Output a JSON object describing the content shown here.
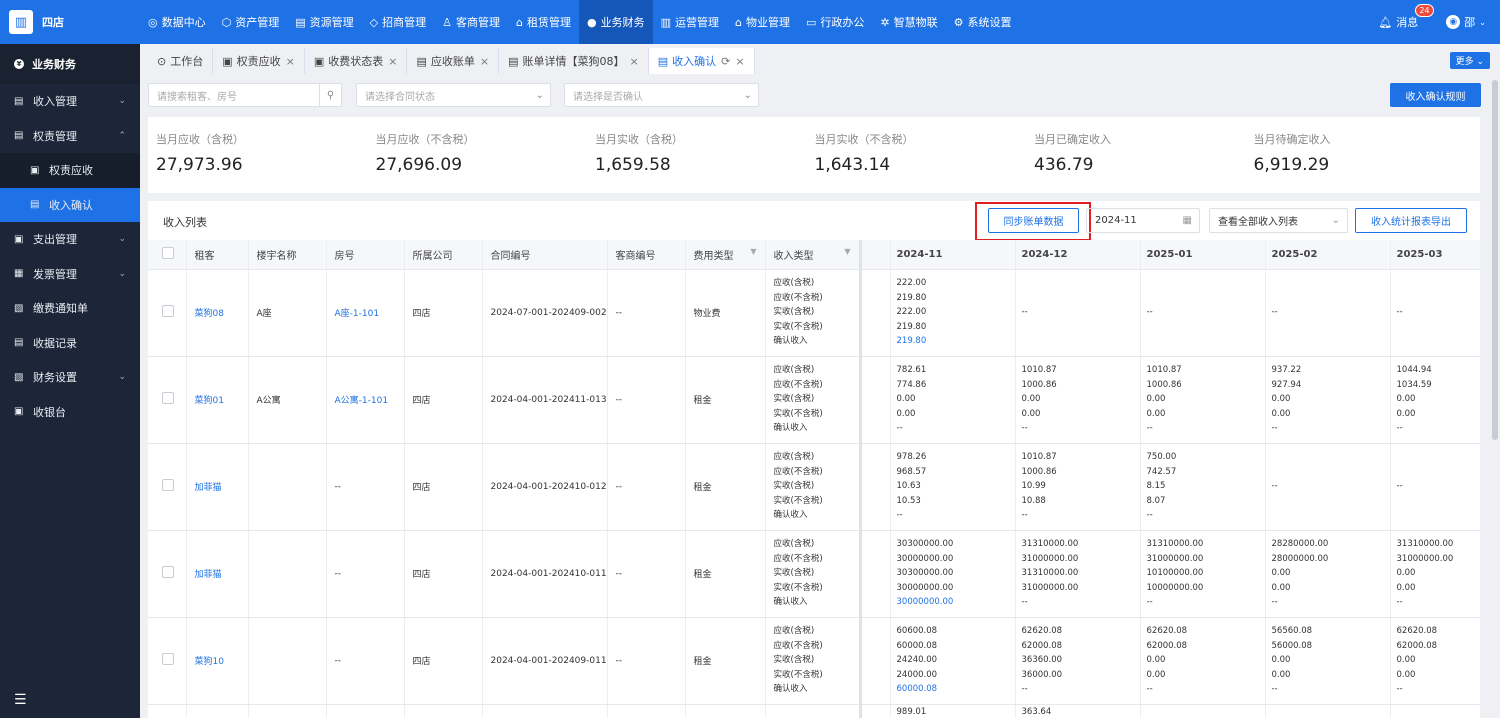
{
  "app": {
    "logo_icon": "building-icon",
    "org_name": "四店"
  },
  "nav": [
    {
      "icon": "◎",
      "label": "数据中心"
    },
    {
      "icon": "⬡",
      "label": "资产管理"
    },
    {
      "icon": "▤",
      "label": "资源管理"
    },
    {
      "icon": "◇",
      "label": "招商管理"
    },
    {
      "icon": "♙",
      "label": "客商管理"
    },
    {
      "icon": "⌂",
      "label": "租赁管理"
    },
    {
      "icon": "●",
      "label": "业务财务"
    },
    {
      "icon": "▥",
      "label": "运营管理"
    },
    {
      "icon": "⌂",
      "label": "物业管理"
    },
    {
      "icon": "▭",
      "label": "行政办公"
    },
    {
      "icon": "✲",
      "label": "智慧物联"
    },
    {
      "icon": "⚙",
      "label": "系统设置"
    }
  ],
  "header": {
    "msg_label": "消息",
    "msg_count": "24",
    "user": "邵"
  },
  "sidebar": {
    "title": "业务财务",
    "items": [
      {
        "icon": "▤",
        "label": "收入管理",
        "chev": "⌄"
      },
      {
        "icon": "▤",
        "label": "权责管理",
        "chev": "⌃"
      },
      {
        "icon": "▣",
        "label": "权责应收"
      },
      {
        "icon": "▤",
        "label": "收入确认"
      },
      {
        "icon": "▣",
        "label": "支出管理",
        "chev": "⌄"
      },
      {
        "icon": "▦",
        "label": "发票管理",
        "chev": "⌄"
      },
      {
        "icon": "▧",
        "label": "缴费通知单"
      },
      {
        "icon": "▤",
        "label": "收据记录"
      },
      {
        "icon": "▧",
        "label": "财务设置",
        "chev": "⌄"
      },
      {
        "icon": "▣",
        "label": "收银台"
      }
    ],
    "bottom_icon": "☰"
  },
  "tabs": [
    {
      "icon": "⊙",
      "label": "工作台",
      "close": ""
    },
    {
      "icon": "▣",
      "label": "权责应收",
      "close": "×"
    },
    {
      "icon": "▣",
      "label": "收费状态表",
      "close": "×"
    },
    {
      "icon": "▤",
      "label": "应收账单",
      "close": "×"
    },
    {
      "icon": "▤",
      "label": "账单详情【菜狗08】",
      "close": "×"
    },
    {
      "icon": "▤",
      "label": "收入确认",
      "close": "×",
      "refresh": "⟳"
    }
  ],
  "more_label": "更多 ⌄",
  "filters": {
    "search_placeholder": "请搜索租客、房号",
    "contract_placeholder": "请选择合同状态",
    "confirm_placeholder": "请选择是否确认"
  },
  "rule_button": "收入确认规则",
  "stats": [
    {
      "label": "当月应收（含税）",
      "value": "27,973.96"
    },
    {
      "label": "当月应收（不含税）",
      "value": "27,696.09"
    },
    {
      "label": "当月实收（含税）",
      "value": "1,659.58"
    },
    {
      "label": "当月实收（不含税）",
      "value": "1,643.14"
    },
    {
      "label": "当月已确定收入",
      "value": "436.79"
    },
    {
      "label": "当月待确定收入",
      "value": "6,919.29"
    }
  ],
  "list": {
    "title": "收入列表",
    "sync_button": "同步账单数据",
    "date_value": "2024-11",
    "view_select": "查看全部收入列表",
    "export_button": "收入统计报表导出"
  },
  "columns": [
    "租客",
    "楼宇名称",
    "房号",
    "所属公司",
    "合同编号",
    "客商编号",
    "费用类型",
    "收入类型"
  ],
  "months": [
    "2024-11",
    "2024-12",
    "2025-01",
    "2025-02",
    "2025-03"
  ],
  "income_types": [
    "应收(含税)",
    "应收(不含税)",
    "实收(含税)",
    "实收(不含税)",
    "确认收入"
  ],
  "rows": [
    {
      "tenant": "菜狗08",
      "building": "A座",
      "room": "A座-1-101",
      "company": "四店",
      "contract": "2024-07-001-202409-0028",
      "merchant": "--",
      "fee": "物业费",
      "m": [
        [
          "222.00",
          "219.80",
          "222.00",
          "219.80",
          "219.80"
        ],
        [
          "--"
        ],
        [
          "--"
        ],
        [
          "--"
        ],
        [
          "--"
        ]
      ]
    },
    {
      "tenant": "菜狗01",
      "building": "A公寓",
      "room": "A公寓-1-101",
      "company": "四店",
      "contract": "2024-04-001-202411-0132",
      "merchant": "--",
      "fee": "租金",
      "m": [
        [
          "782.61",
          "774.86",
          "0.00",
          "0.00",
          "--"
        ],
        [
          "1010.87",
          "1000.86",
          "0.00",
          "0.00",
          "--"
        ],
        [
          "1010.87",
          "1000.86",
          "0.00",
          "0.00",
          "--"
        ],
        [
          "937.22",
          "927.94",
          "0.00",
          "0.00",
          "--"
        ],
        [
          "1044.94",
          "1034.59",
          "0.00",
          "0.00",
          "--"
        ]
      ]
    },
    {
      "tenant": "加菲猫",
      "building": "",
      "room": "--",
      "company": "四店",
      "contract": "2024-04-001-202410-0125",
      "merchant": "--",
      "fee": "租金",
      "m": [
        [
          "978.26",
          "968.57",
          "10.63",
          "10.53",
          "--"
        ],
        [
          "1010.87",
          "1000.86",
          "10.99",
          "10.88",
          "--"
        ],
        [
          "750.00",
          "742.57",
          "8.15",
          "8.07",
          "--"
        ],
        [
          "--"
        ],
        [
          "--"
        ]
      ]
    },
    {
      "tenant": "加菲猫",
      "building": "",
      "room": "--",
      "company": "四店",
      "contract": "2024-04-001-202410-0119",
      "merchant": "--",
      "fee": "租金",
      "m": [
        [
          "30300000.00",
          "30000000.00",
          "30300000.00",
          "30000000.00",
          "30000000.00"
        ],
        [
          "31310000.00",
          "31000000.00",
          "31310000.00",
          "31000000.00",
          "--"
        ],
        [
          "31310000.00",
          "31000000.00",
          "10100000.00",
          "10000000.00",
          "--"
        ],
        [
          "28280000.00",
          "28000000.00",
          "0.00",
          "0.00",
          "--"
        ],
        [
          "31310000.00",
          "31000000.00",
          "0.00",
          "0.00",
          "--"
        ]
      ]
    },
    {
      "tenant": "菜狗10",
      "building": "",
      "room": "--",
      "company": "四店",
      "contract": "2024-04-001-202409-0113",
      "merchant": "--",
      "fee": "租金",
      "m": [
        [
          "60600.08",
          "60000.08",
          "24240.00",
          "24000.00",
          "60000.08"
        ],
        [
          "62620.08",
          "62000.08",
          "36360.00",
          "36000.00",
          "--"
        ],
        [
          "62620.08",
          "62000.08",
          "0.00",
          "0.00",
          "--"
        ],
        [
          "56560.08",
          "56000.08",
          "0.00",
          "0.00",
          "--"
        ],
        [
          "62620.08",
          "62000.08",
          "0.00",
          "0.00",
          "--"
        ]
      ]
    },
    {
      "tenant": "",
      "building": "",
      "room": "",
      "company": "",
      "contract": "",
      "merchant": "",
      "fee": "",
      "m": [
        [
          "989.01"
        ],
        [
          "363.64"
        ],
        [
          ""
        ],
        [
          ""
        ],
        [
          ""
        ]
      ]
    }
  ]
}
